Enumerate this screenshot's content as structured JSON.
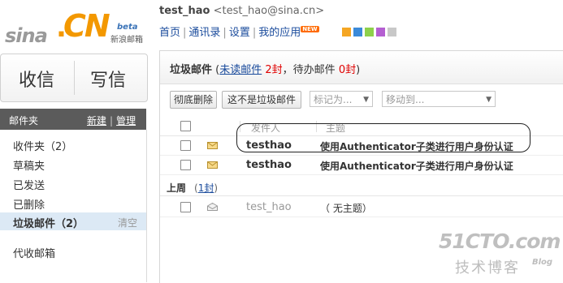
{
  "logo": {
    "text_sina": "sina",
    "text_dot": ".",
    "text_cn": "CN",
    "beta": "beta",
    "sub": "新浪邮箱"
  },
  "header": {
    "user_name": "test_hao",
    "user_email": "<test_hao@sina.cn>"
  },
  "topnav": {
    "items": [
      "首页",
      "通讯录",
      "设置",
      "我的应用"
    ],
    "new_badge": "NEW",
    "swatches": [
      "#f5a623",
      "#3b8ad9",
      "#8ed14b",
      "#b45fd1",
      "#c8c8c8"
    ]
  },
  "buttons": {
    "receive": "收信",
    "compose": "写信"
  },
  "folders": {
    "title": "邮件夹",
    "new_label": "新建",
    "separator": "|",
    "manage_label": "管理",
    "items": [
      "收件夹（2）",
      "草稿夹",
      "已发送",
      "已删除",
      "垃圾邮件（2）",
      "代收邮箱"
    ],
    "clear_label": "清空"
  },
  "main": {
    "title": "垃圾邮件",
    "unread_prefix": "(",
    "unread_link": "未读邮件",
    "unread_count": "2封",
    "pending_text": "，待办邮件",
    "pending_count": "0封",
    "suffix": ")",
    "toolbar": {
      "delete_all": "彻底删除",
      "not_spam": "这不是垃圾邮件",
      "mark_as": "标记为...",
      "move_to": "移动到..."
    },
    "columns": {
      "sender": "发件人",
      "subject": "主题"
    },
    "rows": [
      {
        "sender": "testhao",
        "subject": "使用Authenticator子类进行用户身份认证"
      },
      {
        "sender": "testhao",
        "subject": "使用Authenticator子类进行用户身份认证"
      }
    ],
    "group": {
      "label": "上周",
      "count_open": "(",
      "count": "1封",
      "count_close": ")"
    },
    "read_rows": [
      {
        "sender": "test_hao",
        "subject": "（ 无主题）"
      }
    ]
  },
  "watermark": {
    "line1": "51CTO.com",
    "line2": "技术博客",
    "line3": "Blog"
  }
}
